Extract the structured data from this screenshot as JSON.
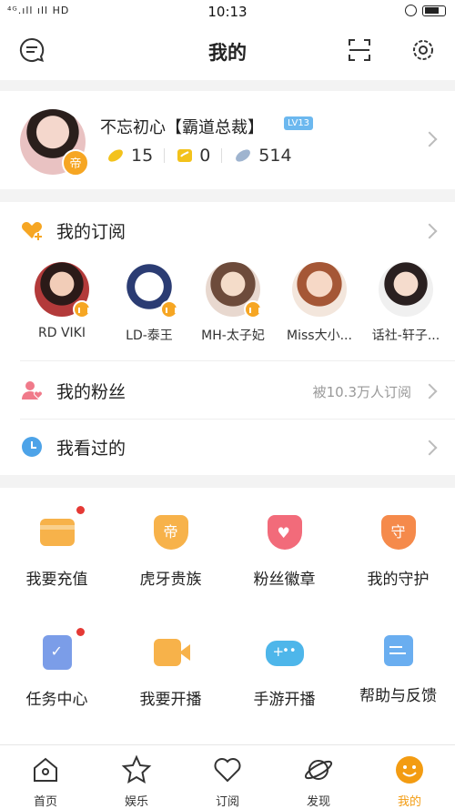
{
  "status": {
    "left": "⁴ᴳ.ıll ıll HD",
    "time": "10:13"
  },
  "header": {
    "title": "我的",
    "messages_icon": "message-icon",
    "scan_icon": "scan-icon",
    "settings_icon": "gear-icon"
  },
  "profile": {
    "name": "不忘初心【霸道总裁】",
    "level": "LV13",
    "badge": "帝",
    "stats": [
      {
        "value": "15"
      },
      {
        "value": "0"
      },
      {
        "value": "514"
      }
    ]
  },
  "subscriptions": {
    "title": "我的订阅",
    "anchors": [
      "RD VIKI",
      "LD-泰王",
      "MH-太子妃",
      "Miss大小...",
      "话社-轩子..."
    ]
  },
  "fans": {
    "title": "我的粉丝",
    "extra": "被10.3万人订阅"
  },
  "history": {
    "title": "我看过的"
  },
  "grid": [
    {
      "label": "我要充值"
    },
    {
      "label": "虎牙贵族"
    },
    {
      "label": "粉丝徽章"
    },
    {
      "label": "我的守护"
    },
    {
      "label": "任务中心"
    },
    {
      "label": "我要开播"
    },
    {
      "label": "手游开播"
    },
    {
      "label": "帮助与反馈"
    }
  ],
  "grid_badges": {
    "noble": "帝",
    "guard": "守"
  },
  "tabs": [
    {
      "label": "首页"
    },
    {
      "label": "娱乐"
    },
    {
      "label": "订阅"
    },
    {
      "label": "发现"
    },
    {
      "label": "我的"
    }
  ],
  "colors": {
    "accent": "#f39c12",
    "level": "#6cb8ef",
    "notice": "#e53935"
  }
}
